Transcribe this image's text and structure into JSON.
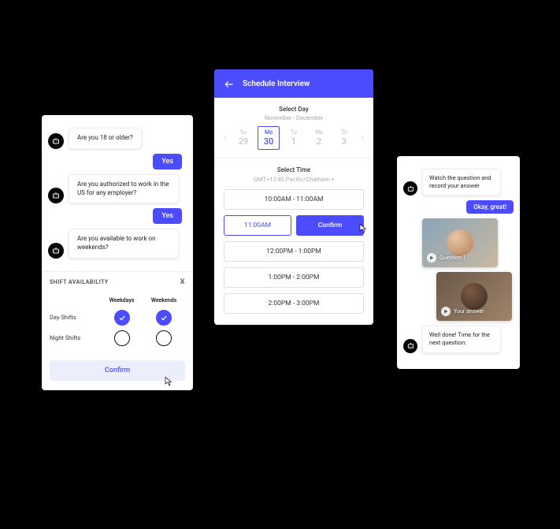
{
  "cardA": {
    "bot1": "Are you 18 or older?",
    "user1": "Yes",
    "bot2": "Are you authorized to work in the US for any employer?",
    "user2": "Yes",
    "bot3": "Are you available to work on weekends?",
    "shift_header": "SHIFT AVAILABILITY",
    "col1": "Weekdays",
    "col2": "Weekends",
    "row1": "Day Shifts",
    "row2": "Night Shifts",
    "confirm": "Confirm"
  },
  "cardB": {
    "title": "Schedule Interview",
    "select_day": "Select Day",
    "month_range": "November - December",
    "days": [
      {
        "dow": "Su",
        "num": "29"
      },
      {
        "dow": "Mo",
        "num": "30"
      },
      {
        "dow": "Tu",
        "num": "1"
      },
      {
        "dow": "We",
        "num": "2"
      },
      {
        "dow": "Th",
        "num": "3"
      }
    ],
    "select_time": "Select Time",
    "timezone": "GMT+12:45 Pacific/Chatham",
    "slot0": "10:00AM - 11:00AM",
    "slot1_time": "11:00AM",
    "slot1_confirm": "Confirm",
    "slot2": "12:00PM - 1:00PM",
    "slot3": "1:00PM - 2:00PM",
    "slot4": "2:00PM - 3:00PM"
  },
  "cardC": {
    "bot1": "Watch the question and record your answer",
    "user1": "Okay, great!",
    "q_label": "Question 1",
    "a_label": "Your answer",
    "bot2": "Well done! Time for the next question:"
  }
}
